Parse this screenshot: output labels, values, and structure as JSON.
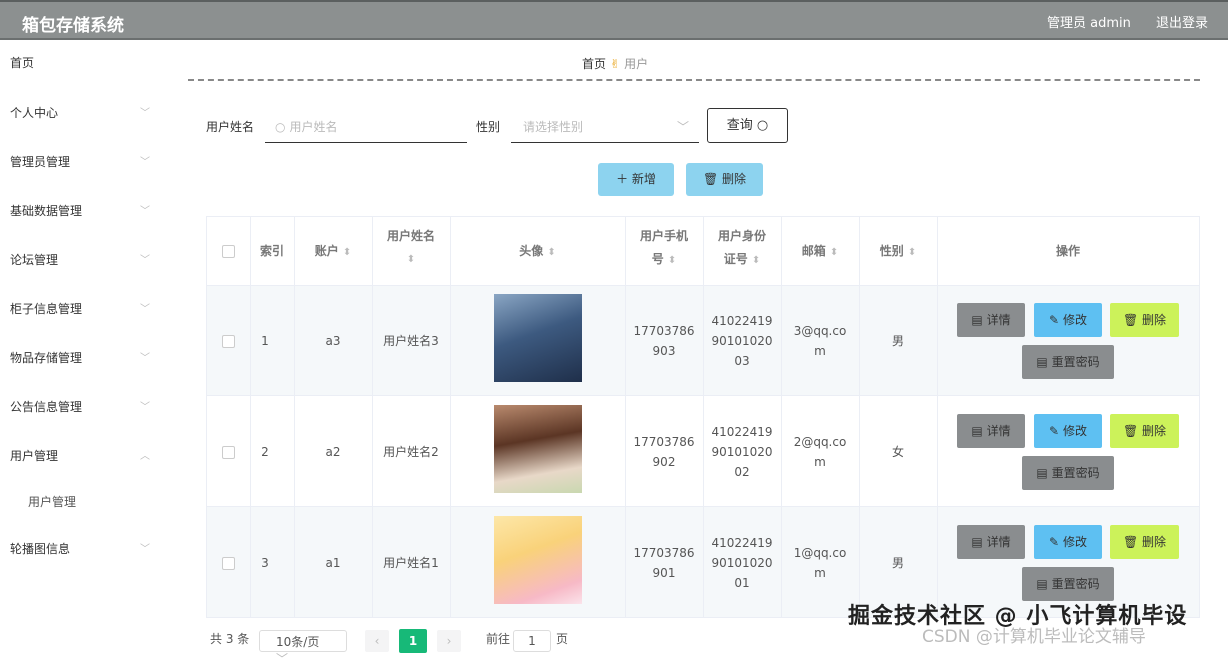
{
  "header": {
    "title": "箱包存储系统",
    "admin_label": "管理员 admin",
    "logout_label": "退出登录"
  },
  "sidebar": {
    "items": [
      {
        "label": "首页",
        "expandable": false
      },
      {
        "label": "个人中心",
        "expandable": true
      },
      {
        "label": "管理员管理",
        "expandable": true
      },
      {
        "label": "基础数据管理",
        "expandable": true
      },
      {
        "label": "论坛管理",
        "expandable": true
      },
      {
        "label": "柜子信息管理",
        "expandable": true
      },
      {
        "label": "物品存储管理",
        "expandable": true
      },
      {
        "label": "公告信息管理",
        "expandable": true
      },
      {
        "label": "用户管理",
        "expandable": true,
        "expanded": true
      },
      {
        "label": "轮播图信息",
        "expandable": true
      }
    ],
    "sub_item": "用户管理"
  },
  "breadcrumb": {
    "home": "首页",
    "current": "用户"
  },
  "search": {
    "username_label": "用户姓名",
    "username_placeholder": "用户姓名",
    "gender_label": "性别",
    "gender_placeholder": "请选择性别",
    "query_label": "查询"
  },
  "actions": {
    "add_label": "新增",
    "delete_label": "删除"
  },
  "table": {
    "headers": {
      "index": "索引",
      "account": "账户",
      "name_line1": "用户姓名",
      "avatar": "头像",
      "phone_line1": "用户手机",
      "phone_line2": "号",
      "idcard_line1": "用户身份",
      "idcard_line2": "证号",
      "email": "邮箱",
      "gender": "性别",
      "ops": "操作"
    },
    "rows": [
      {
        "index": "1",
        "account": "a3",
        "name": "用户姓名3",
        "phone_1": "17703786",
        "phone_2": "903",
        "idcard_1": "41022419",
        "idcard_2": "90101020",
        "idcard_3": "03",
        "email_1": "3@qq.co",
        "email_2": "m",
        "gender": "男"
      },
      {
        "index": "2",
        "account": "a2",
        "name": "用户姓名2",
        "phone_1": "17703786",
        "phone_2": "902",
        "idcard_1": "41022419",
        "idcard_2": "90101020",
        "idcard_3": "02",
        "email_1": "2@qq.co",
        "email_2": "m",
        "gender": "女"
      },
      {
        "index": "3",
        "account": "a1",
        "name": "用户姓名1",
        "phone_1": "17703786",
        "phone_2": "901",
        "idcard_1": "41022419",
        "idcard_2": "90101020",
        "idcard_3": "01",
        "email_1": "1@qq.co",
        "email_2": "m",
        "gender": "男"
      }
    ],
    "row_buttons": {
      "detail": "详情",
      "edit": "修改",
      "delete": "删除",
      "reset": "重置密码"
    }
  },
  "pagination": {
    "total": "共 3 条",
    "page_size": "10条/页",
    "current_page": "1",
    "goto_label": "前往",
    "goto_value": "1",
    "page_suffix": "页"
  },
  "watermark": {
    "line1": "掘金技术社区 @ 小飞计算机毕设",
    "line2": "CSDN @计算机毕业论文辅导"
  },
  "colors": {
    "topbar": "#8c9090",
    "primary_btn": "#8dd3ef",
    "edit_btn": "#5ec0f2",
    "delete_btn": "#ccf25a",
    "detail_btn": "#8a8d8f",
    "page_active": "#17b978"
  }
}
